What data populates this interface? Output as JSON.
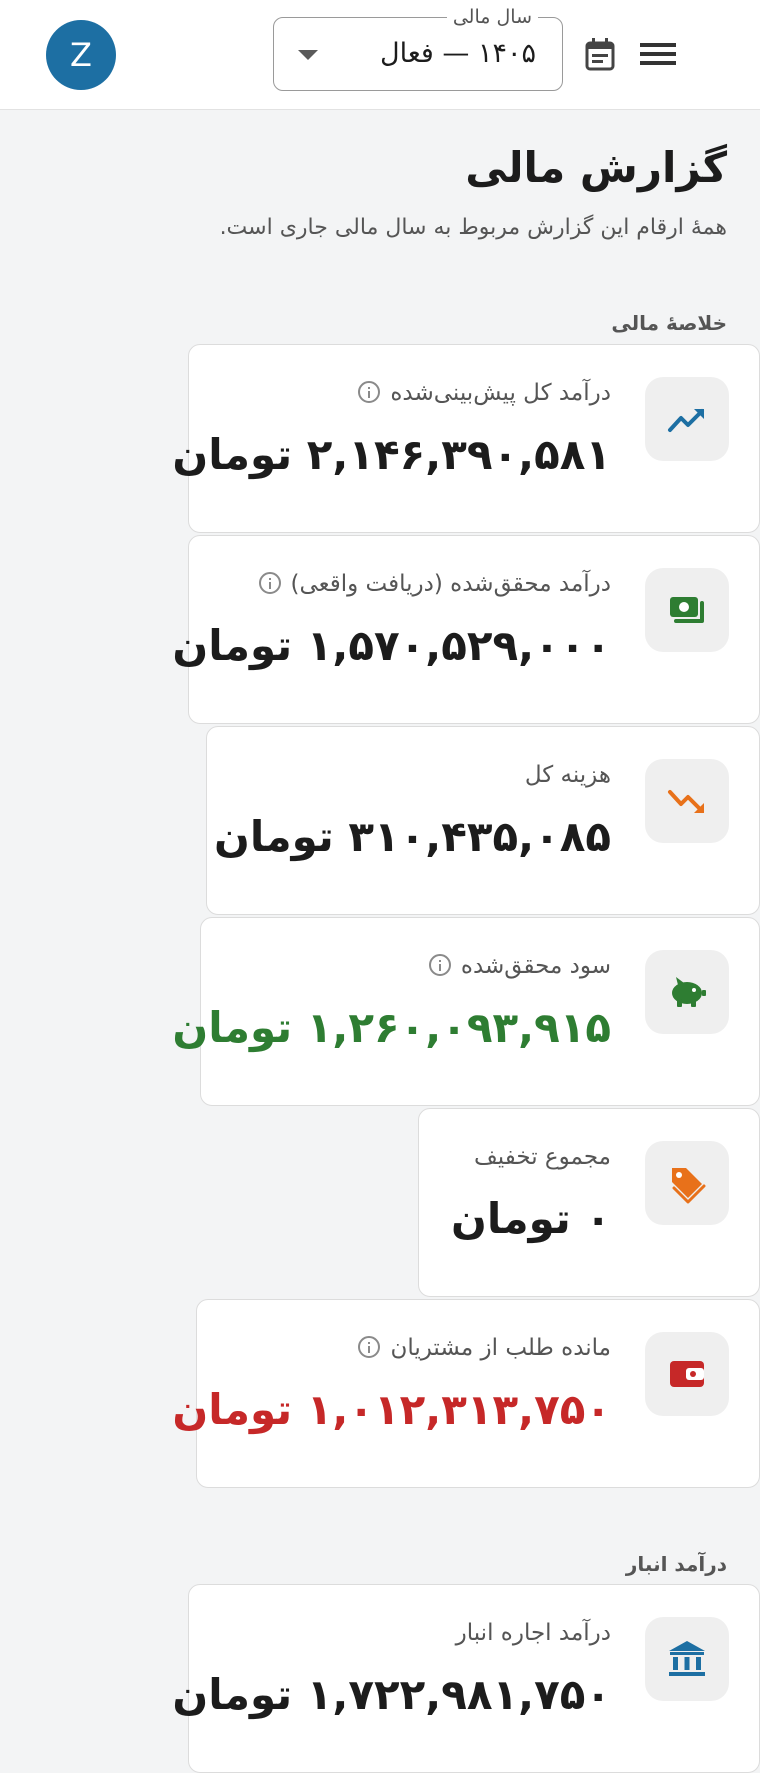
{
  "app_bar": {
    "avatar_letter": "Z",
    "fiscal_year_label": "سال مالی",
    "fiscal_year_value": "۱۴۰۵ — فعال"
  },
  "page": {
    "title": "گزارش مالی",
    "subtitle": "همهٔ ارقام این گزارش مربوط به سال مالی جاری است."
  },
  "sections": {
    "summary_title": "خلاصهٔ مالی",
    "warehouse_title": "درآمد انبار"
  },
  "cards": {
    "forecast_income": {
      "label": "درآمد کل پیش‌بینی‌شده",
      "value": "۲,۱۴۶,۳۹۰,۵۸۱ تومان",
      "icon": "trending-up-icon",
      "icon_color": "#1d6fa3"
    },
    "realized_income": {
      "label": "درآمد محقق‌شده (دریافت واقعی)",
      "value": "۱,۵۷۰,۵۲۹,۰۰۰ تومان",
      "icon": "cash-icon",
      "icon_color": "#2e7d32"
    },
    "total_expense": {
      "label": "هزینه کل",
      "value": "۳۱۰,۴۳۵,۰۸۵ تومان",
      "icon": "trending-down-icon",
      "icon_color": "#e8711a"
    },
    "realized_profit": {
      "label": "سود محقق‌شده",
      "value": "۱,۲۶۰,۰۹۳,۹۱۵ تومان",
      "icon": "piggy-bank-icon",
      "icon_color": "#2e7d32",
      "value_color": "#2e7d32"
    },
    "total_discount": {
      "label": "مجموع تخفیف",
      "value": "۰ تومان",
      "icon": "tag-icon",
      "icon_color": "#e8711a"
    },
    "customer_debt": {
      "label": "مانده طلب از مشتریان",
      "value": "۱,۰۱۲,۳۱۳,۷۵۰ تومان",
      "icon": "wallet-icon",
      "icon_color": "#c62828",
      "value_color": "#c62828"
    },
    "warehouse_rent": {
      "label": "درآمد اجاره انبار",
      "value": "۱,۷۲۲,۹۸۱,۷۵۰ تومان",
      "icon": "bank-icon",
      "icon_color": "#1d6fa3"
    }
  }
}
